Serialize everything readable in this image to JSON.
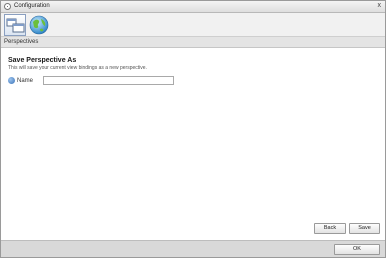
{
  "window": {
    "title": "Configuration",
    "close_glyph": "x"
  },
  "toolbar": {
    "items": [
      {
        "icon": "perspectives-icon",
        "active": true
      },
      {
        "icon": "globe-icon",
        "active": false
      }
    ]
  },
  "section": {
    "label": "Perspectives"
  },
  "form": {
    "heading": "Save Perspective As",
    "description": "This will save your current view bindings as a new perspective.",
    "name_label": "Name",
    "name_value": ""
  },
  "buttons": {
    "back": "Back",
    "save": "Save",
    "ok": "OK"
  },
  "colors": {
    "accent": "#3b72b8"
  }
}
